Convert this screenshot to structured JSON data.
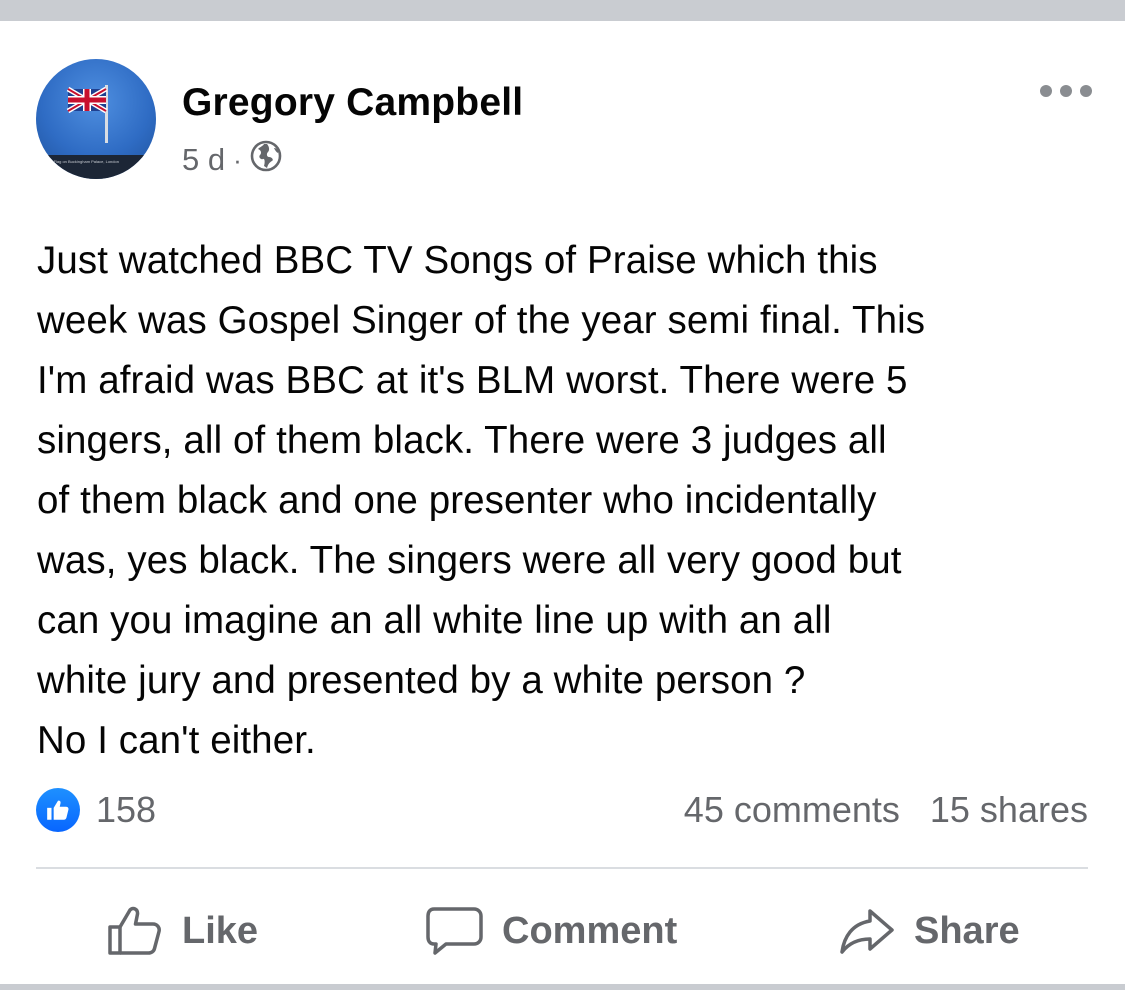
{
  "post": {
    "author": "Gregory Campbell",
    "time": "5 d",
    "separator": "·",
    "avatar_caption": "Union Flag on Buckingham Palace, London",
    "text": "Just watched BBC TV Songs of Praise which this\nweek was Gospel Singer of the year semi final. This\nI'm afraid was BBC at it's BLM worst. There were 5\nsingers, all of them black. There were 3 judges all\nof them black and one presenter who incidentally\nwas, yes black. The singers were all very good but\ncan you imagine an all white line up with an all\nwhite jury and presented by a white person ?\nNo I can't either.",
    "reactions_count": "158",
    "comments": "45 comments",
    "shares": "15 shares"
  },
  "actions": {
    "like": "Like",
    "comment": "Comment",
    "share": "Share"
  },
  "icons": {
    "privacy": "globe-icon",
    "more": "more-options-icon",
    "reaction": "like-reaction-icon"
  },
  "colors": {
    "accent": "#0866ff",
    "secondary_text": "#65676b",
    "primary_text": "#050505"
  }
}
